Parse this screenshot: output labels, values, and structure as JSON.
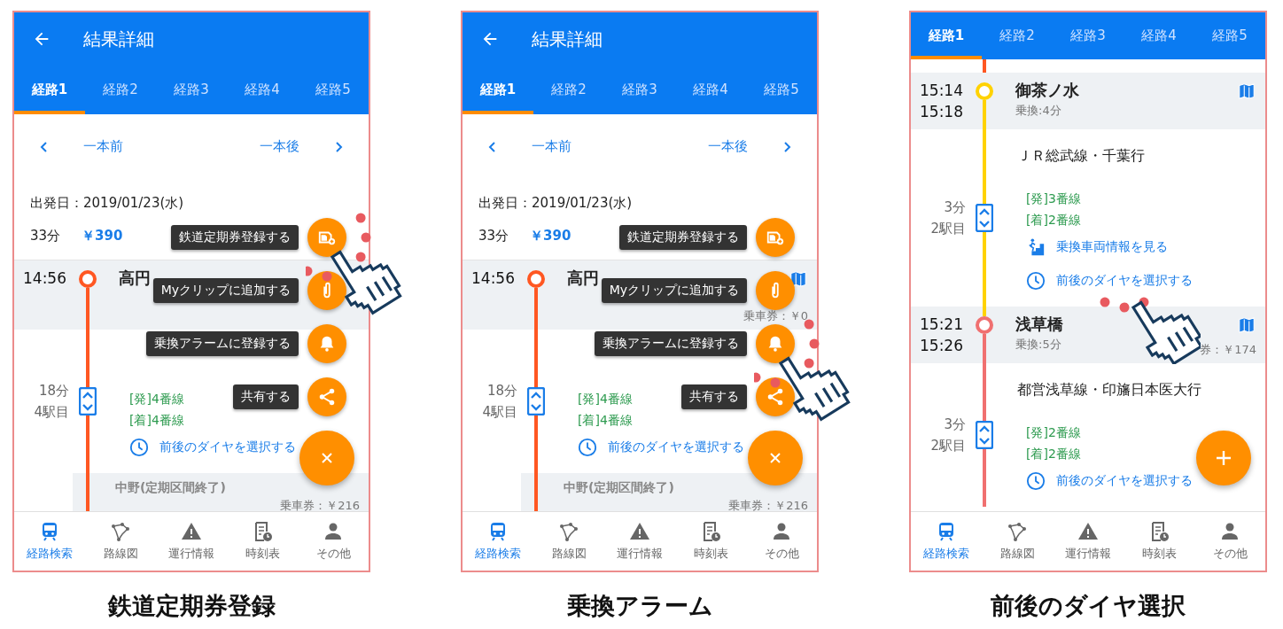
{
  "panels": [
    {
      "kind": "menu",
      "caption": "鉄道定期券登録",
      "header": {
        "title": "結果詳細"
      },
      "tabs": [
        {
          "label": "経路1",
          "selected": true
        },
        {
          "label": "経路2",
          "selected": false
        },
        {
          "label": "経路3",
          "selected": false
        },
        {
          "label": "経路4",
          "selected": false
        },
        {
          "label": "経路5",
          "selected": false
        }
      ],
      "nav": {
        "prev": "一本前",
        "next": "一本後"
      },
      "summary": {
        "date": "出発日：2019/01/23(水)",
        "duration": "33分",
        "fare": "￥390"
      },
      "route": [
        {
          "kind": "station",
          "times": [
            "14:56"
          ],
          "name": "高円",
          "color": "#ff5722"
        },
        {
          "kind": "segment",
          "color": "#ff5722",
          "duration": "18分",
          "stops": "4駅目",
          "platforms": [
            "[発]4番線",
            "[着]4番線"
          ],
          "links": [
            {
              "kind": "timetable",
              "label": "前後のダイヤを選択する",
              "tapped": false
            }
          ]
        },
        {
          "kind": "end",
          "name": "中野(定期区間終了)",
          "fare": "乗車券：￥216"
        }
      ],
      "fab_menu": [
        {
          "kind": "pass",
          "label": "鉄道定期券登録する",
          "tapped": true
        },
        {
          "kind": "clip",
          "label": "Myクリップに追加する",
          "tapped": false
        },
        {
          "kind": "alarm",
          "label": "乗換アラームに登録する",
          "tapped": false
        },
        {
          "kind": "share",
          "label": "共有する",
          "tapped": false
        }
      ],
      "fab": {
        "kind": "close"
      },
      "bottom_nav": [
        {
          "kind": "train",
          "label": "経路検索",
          "selected": true
        },
        {
          "kind": "map",
          "label": "路線図",
          "selected": false
        },
        {
          "kind": "warning",
          "label": "運行情報",
          "selected": false
        },
        {
          "kind": "timetable",
          "label": "時刻表",
          "selected": false
        },
        {
          "kind": "person",
          "label": "その他",
          "selected": false
        }
      ]
    },
    {
      "kind": "menu",
      "caption": "乗換アラーム",
      "header": {
        "title": "結果詳細"
      },
      "tabs": [
        {
          "label": "経路1",
          "selected": true
        },
        {
          "label": "経路2",
          "selected": false
        },
        {
          "label": "経路3",
          "selected": false
        },
        {
          "label": "経路4",
          "selected": false
        },
        {
          "label": "経路5",
          "selected": false
        }
      ],
      "nav": {
        "prev": "一本前",
        "next": "一本後"
      },
      "summary": {
        "date": "出発日：2019/01/23(水)",
        "duration": "33分",
        "fare": "￥390"
      },
      "route": [
        {
          "kind": "station",
          "times": [
            "14:56"
          ],
          "name": "高円",
          "fare": "乗車券：￥0",
          "map": true,
          "color": "#ff5722"
        },
        {
          "kind": "segment",
          "color": "#ff5722",
          "duration": "18分",
          "stops": "4駅目",
          "platforms": [
            "[発]4番線",
            "[着]4番線"
          ],
          "links": [
            {
              "kind": "timetable",
              "label": "前後のダイヤを選択する",
              "tapped": false
            }
          ]
        },
        {
          "kind": "end",
          "name": "中野(定期区間終了)",
          "fare": "乗車券：￥216"
        }
      ],
      "fab_menu": [
        {
          "kind": "pass",
          "label": "鉄道定期券登録する",
          "tapped": false
        },
        {
          "kind": "clip",
          "label": "Myクリップに追加する",
          "tapped": false
        },
        {
          "kind": "alarm",
          "label": "乗換アラームに登録する",
          "tapped": true
        },
        {
          "kind": "share",
          "label": "共有する",
          "tapped": false
        }
      ],
      "fab": {
        "kind": "close"
      },
      "bottom_nav": [
        {
          "kind": "train",
          "label": "経路検索",
          "selected": true
        },
        {
          "kind": "map",
          "label": "路線図",
          "selected": false
        },
        {
          "kind": "warning",
          "label": "運行情報",
          "selected": false
        },
        {
          "kind": "timetable",
          "label": "時刻表",
          "selected": false
        },
        {
          "kind": "person",
          "label": "その他",
          "selected": false
        }
      ]
    },
    {
      "kind": "scrolled",
      "caption": "前後のダイヤ選択",
      "tabs": [
        {
          "label": "経路1",
          "selected": true
        },
        {
          "label": "経路2",
          "selected": false
        },
        {
          "label": "経路3",
          "selected": false
        },
        {
          "label": "経路4",
          "selected": false
        },
        {
          "label": "経路5",
          "selected": false
        }
      ],
      "route": [
        {
          "kind": "station",
          "times": [
            "15:14",
            "15:18"
          ],
          "name": "御茶ノ水",
          "transfer": "乗換:4分",
          "map": true,
          "color": "#ffd200"
        },
        {
          "kind": "segment",
          "color": "#ffd200",
          "line_name": "ＪＲ総武線・千葉行",
          "duration": "3分",
          "stops": "2駅目",
          "platforms": [
            "[発]3番線",
            "[着]2番線"
          ],
          "links": [
            {
              "kind": "car",
              "label": "乗換車両情報を見る",
              "tapped": false
            },
            {
              "kind": "timetable",
              "label": "前後のダイヤを選択する",
              "tapped": true
            }
          ]
        },
        {
          "kind": "station",
          "times": [
            "15:21",
            "15:26"
          ],
          "name": "浅草橋",
          "transfer": "乗換:5分",
          "fare": "券：￥174",
          "map": true,
          "color": "#f07070"
        },
        {
          "kind": "segment",
          "color": "#f07070",
          "line_name": "都営浅草線・印旛日本医大行",
          "duration": "3分",
          "stops": "2駅目",
          "platforms": [
            "[発]2番線",
            "[着]2番線"
          ],
          "links": [
            {
              "kind": "timetable",
              "label": "前後のダイヤを選択する",
              "tapped": false
            }
          ]
        }
      ],
      "fab": {
        "kind": "add"
      },
      "bottom_nav": [
        {
          "kind": "train",
          "label": "経路検索",
          "selected": true
        },
        {
          "kind": "map",
          "label": "路線図",
          "selected": false
        },
        {
          "kind": "warning",
          "label": "運行情報",
          "selected": false
        },
        {
          "kind": "timetable",
          "label": "時刻表",
          "selected": false
        },
        {
          "kind": "person",
          "label": "その他",
          "selected": false
        }
      ]
    }
  ]
}
